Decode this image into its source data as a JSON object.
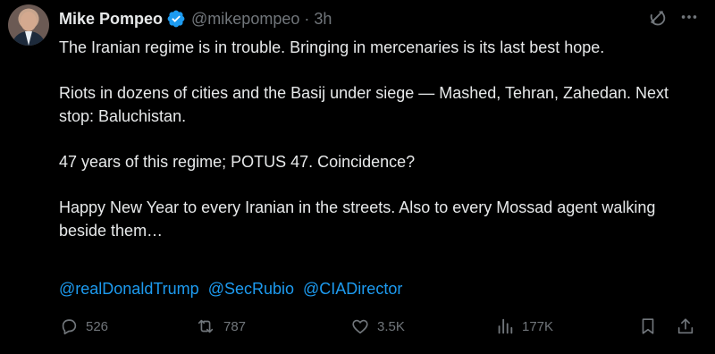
{
  "author": {
    "name": "Mike Pompeo",
    "handle": "@mikepompeo",
    "separator": "·",
    "time": "3h"
  },
  "icons": {
    "verified": "verified-badge-icon",
    "grok": "grok-icon",
    "more": "more-icon",
    "reply": "reply-icon",
    "repost": "repost-icon",
    "like": "like-icon",
    "views": "views-icon",
    "bookmark": "bookmark-icon",
    "share": "share-icon"
  },
  "colors": {
    "background": "#000000",
    "text": "#e7e9ea",
    "muted": "#71767b",
    "link": "#1d9bf0"
  },
  "tweet": {
    "paragraphs": [
      "The Iranian regime is in trouble. Bringing in mercenaries is its last best hope.",
      "Riots in dozens of cities and the Basij under siege — Mashed, Tehran, Zahedan.  Next stop:  Baluchistan.",
      "47 years of this regime; POTUS 47.  Coincidence?",
      "Happy New Year to every Iranian in the streets.  Also to every Mossad agent walking beside them…"
    ],
    "mentions": [
      "@realDonaldTrump",
      "@SecRubio",
      "@CIADirector"
    ]
  },
  "stats": {
    "replies": "526",
    "reposts": "787",
    "likes": "3.5K",
    "views": "177K"
  }
}
